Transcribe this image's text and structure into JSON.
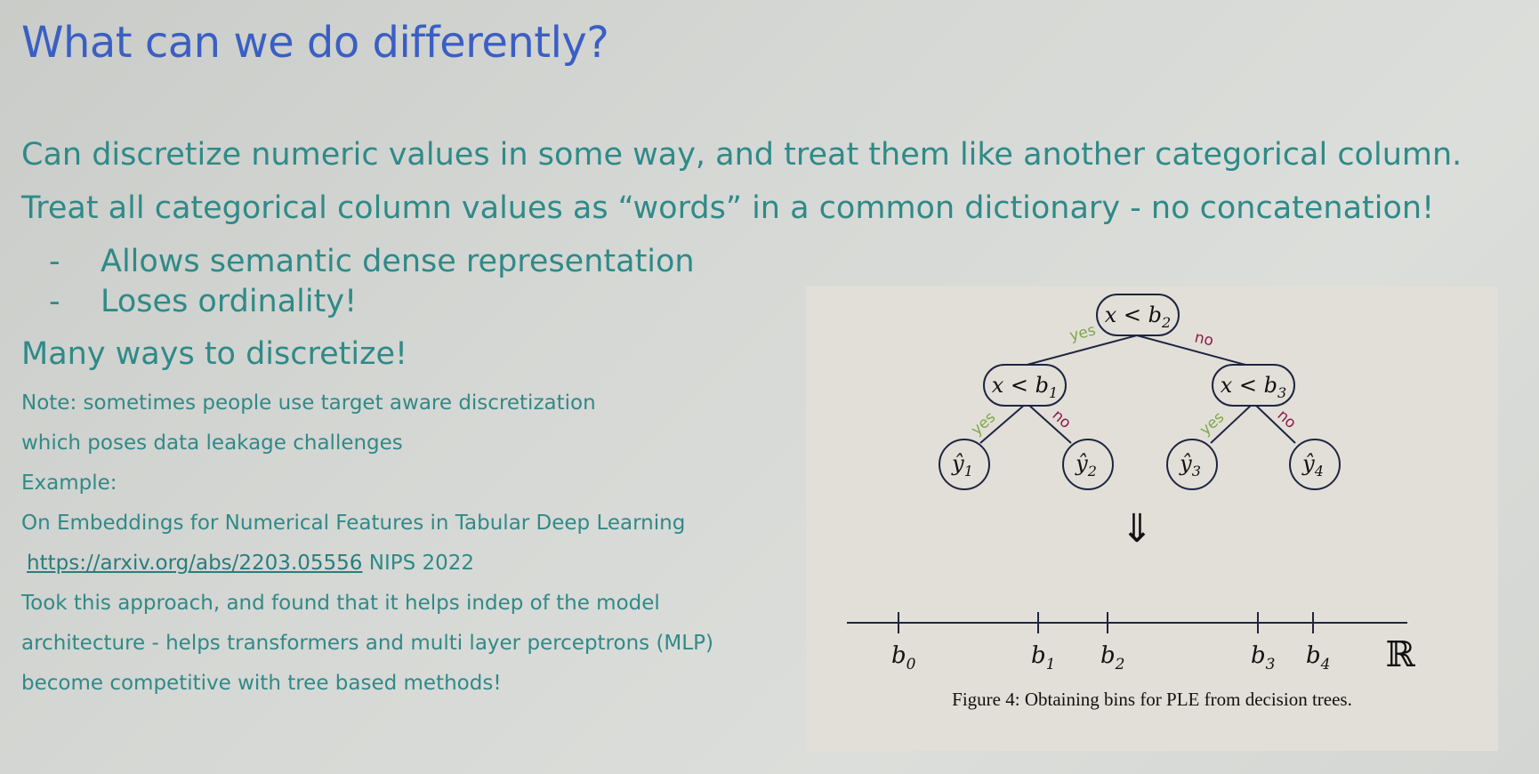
{
  "title": "What can we do differently?",
  "lines": {
    "l1": "Can discretize numeric values in some way, and treat them like another categorical column.",
    "l2": "Treat all categorical column values as “words” in a common dictionary - no concatenation!",
    "b1": "Allows semantic dense representation",
    "b2": "Loses ordinality!",
    "dash": "-",
    "l3": "Many ways to discretize!",
    "s1": "Note: sometimes people use target aware discretization",
    "s2": "which poses data leakage challenges",
    "s3": "Example:",
    "s4": "On Embeddings for Numerical Features in Tabular Deep Learning",
    "link": "https://arxiv.org/abs/2203.05556",
    "link_suffix": " NIPS 2022",
    "s6": "Took this approach, and found that it helps indep of the model",
    "s7": "architecture - helps transformers and multi layer perceptrons (MLP)",
    "s8": "become competitive with tree based methods!"
  },
  "figure": {
    "root": "x < b",
    "root_sub": "2",
    "left": "x < b",
    "left_sub": "1",
    "right": "x < b",
    "right_sub": "3",
    "yes": "yes",
    "no": "no",
    "leaves": [
      "ŷ",
      "ŷ",
      "ŷ",
      "ŷ"
    ],
    "leaf_subs": [
      "1",
      "2",
      "3",
      "4"
    ],
    "arrow": "⇓",
    "ticks": [
      "b",
      "b",
      "b",
      "b",
      "b"
    ],
    "tick_subs": [
      "0",
      "1",
      "2",
      "3",
      "4"
    ],
    "reals": "ℝ",
    "caption": "Figure 4: Obtaining bins for PLE from decision trees.",
    "yes_color": "#7fa84a",
    "no_color": "#8b1a4a"
  }
}
